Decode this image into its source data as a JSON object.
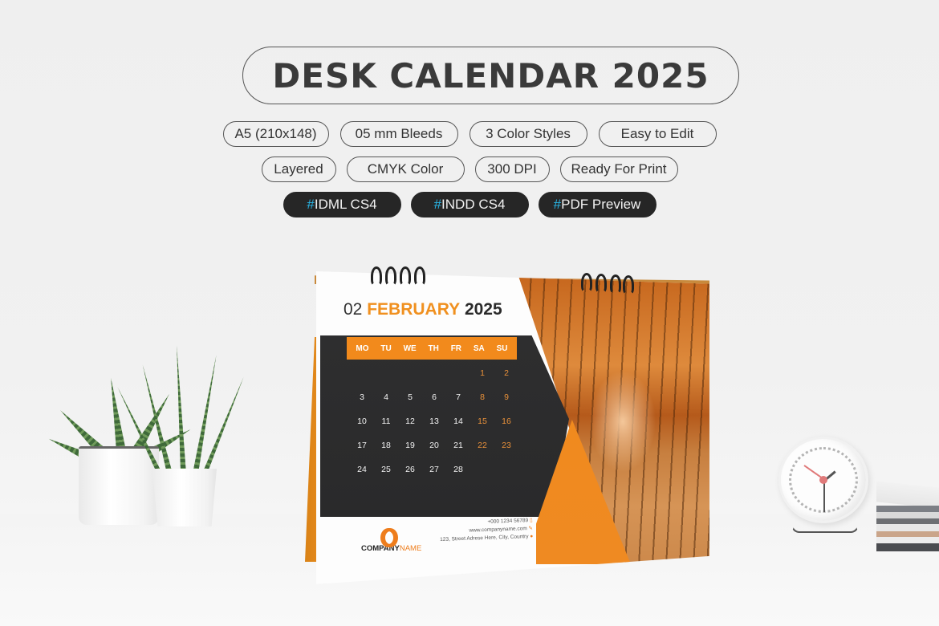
{
  "header": {
    "title": "DESK CALENDAR 2025"
  },
  "features": {
    "row1": [
      "A5 (210x148)",
      "05 mm Bleeds",
      "3 Color Styles",
      "Easy to Edit"
    ],
    "row2": [
      "Layered",
      "CMYK Color",
      "300 DPI",
      "Ready For Print"
    ],
    "row3": [
      {
        "hash": "#",
        "label": "IDML CS4"
      },
      {
        "hash": "#",
        "label": "INDD CS4"
      },
      {
        "hash": "#",
        "label": "PDF Preview"
      }
    ]
  },
  "calendar": {
    "month_number": "02",
    "month_name": "FEBRUARY",
    "year": "2025",
    "weekdays": [
      "MO",
      "TU",
      "WE",
      "TH",
      "FR",
      "SA",
      "SU"
    ],
    "leading_blanks": 5,
    "days": [
      "1",
      "2",
      "3",
      "4",
      "5",
      "6",
      "7",
      "8",
      "9",
      "10",
      "11",
      "12",
      "13",
      "14",
      "15",
      "16",
      "17",
      "18",
      "19",
      "20",
      "21",
      "22",
      "23",
      "24",
      "25",
      "26",
      "27",
      "28"
    ],
    "company": {
      "name_part1": "COMPANY",
      "name_part2": "NAME"
    },
    "contact": {
      "phone": "+000 1234 56789",
      "website": "www.companyname.com",
      "address": "123, Street Adrese Here, City, Country"
    }
  },
  "colors": {
    "accent_orange": "#f28a1c",
    "dark_panel": "#2c2c2d",
    "hashtag_blue": "#29b6e6",
    "title_text": "#3a3a3a"
  }
}
